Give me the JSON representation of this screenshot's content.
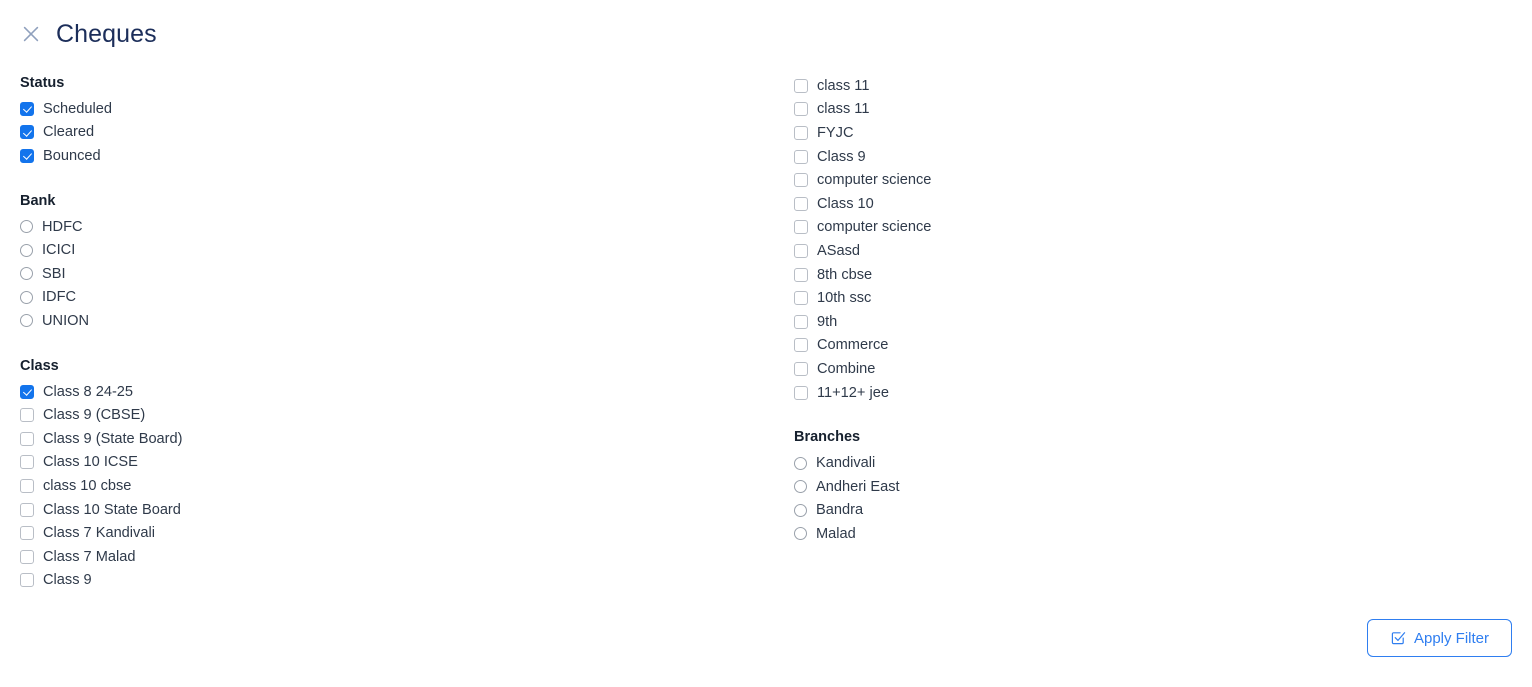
{
  "header": {
    "close_icon": "close-icon",
    "title": "Cheques"
  },
  "left_column": {
    "groups": [
      {
        "title": "Status",
        "control": "checkbox",
        "options": [
          {
            "label": "Scheduled",
            "checked": true
          },
          {
            "label": "Cleared",
            "checked": true
          },
          {
            "label": "Bounced",
            "checked": true
          }
        ]
      },
      {
        "title": "Bank",
        "control": "radio",
        "options": [
          {
            "label": "HDFC",
            "checked": false
          },
          {
            "label": "ICICI",
            "checked": false
          },
          {
            "label": "SBI",
            "checked": false
          },
          {
            "label": "IDFC",
            "checked": false
          },
          {
            "label": "UNION",
            "checked": false
          }
        ]
      },
      {
        "title": "Class",
        "control": "checkbox",
        "options": [
          {
            "label": "Class 8 24-25",
            "checked": true
          },
          {
            "label": "Class 9 (CBSE)",
            "checked": false
          },
          {
            "label": "Class 9 (State Board)",
            "checked": false
          },
          {
            "label": "Class 10 ICSE",
            "checked": false
          },
          {
            "label": "class 10 cbse",
            "checked": false
          },
          {
            "label": "Class 10 State Board",
            "checked": false
          },
          {
            "label": "Class 7 Kandivali",
            "checked": false
          },
          {
            "label": "Class 7 Malad",
            "checked": false
          },
          {
            "label": "Class 9",
            "checked": false
          }
        ]
      }
    ]
  },
  "right_column": {
    "groups": [
      {
        "title": "",
        "control": "checkbox",
        "options": [
          {
            "label": "class 11",
            "checked": false
          },
          {
            "label": "class 11",
            "checked": false
          },
          {
            "label": "FYJC",
            "checked": false
          },
          {
            "label": "Class 9",
            "checked": false
          },
          {
            "label": "computer science",
            "checked": false
          },
          {
            "label": "Class 10",
            "checked": false
          },
          {
            "label": "computer science",
            "checked": false
          },
          {
            "label": "ASasd",
            "checked": false
          },
          {
            "label": "8th cbse",
            "checked": false
          },
          {
            "label": "10th ssc",
            "checked": false
          },
          {
            "label": "9th",
            "checked": false
          },
          {
            "label": "Commerce",
            "checked": false
          },
          {
            "label": "Combine",
            "checked": false
          },
          {
            "label": "11+12+ jee",
            "checked": false
          }
        ]
      },
      {
        "title": "Branches",
        "control": "radio",
        "options": [
          {
            "label": "Kandivali",
            "checked": false
          },
          {
            "label": "Andheri East",
            "checked": false
          },
          {
            "label": "Bandra",
            "checked": false
          },
          {
            "label": "Malad",
            "checked": false
          }
        ]
      }
    ]
  },
  "footer": {
    "apply_label": "Apply Filter",
    "apply_icon": "checkbox-check-icon"
  },
  "colors": {
    "accent": "#1374ec",
    "button_blue": "#2f7ef0",
    "title": "#1c2e5a",
    "label": "#2f3a4a",
    "heading": "#16202e",
    "close_icon": "#8fa0bd",
    "checkbox_border": "#b9bec6",
    "radio_border": "#9aa1ab",
    "background": "#ffffff"
  }
}
